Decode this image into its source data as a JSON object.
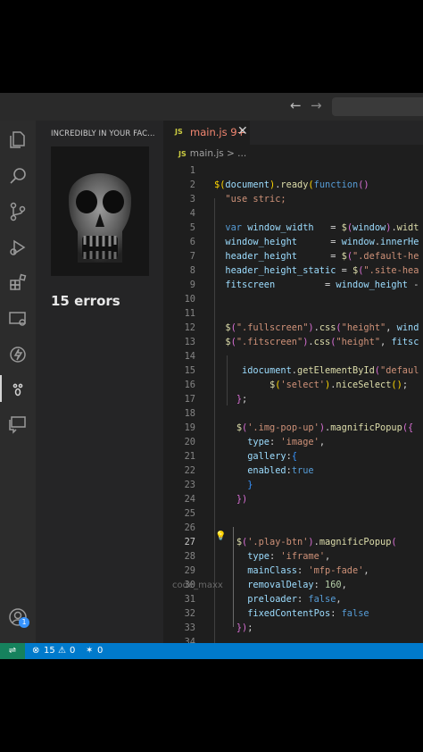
{
  "nav": {
    "back_icon": "arrow-left-icon",
    "forward_icon": "arrow-right-icon"
  },
  "sidebar": {
    "panel_title": "INCREDIBLY IN YOUR FAC...",
    "error_summary": "15 errors",
    "account_badge": "1"
  },
  "tab": {
    "lang_badge": "JS",
    "filename": "main.js 9+",
    "close_glyph": "✕"
  },
  "breadcrumb": {
    "lang_badge": "JS",
    "path": "main.js > ..."
  },
  "watermark": "code_maxx",
  "colors": {
    "status_bar": "#007acc",
    "remote": "#16825d",
    "keyword": "#569cd6",
    "string": "#ce9178",
    "function": "#dcdcaa",
    "variable": "#9cdcfe",
    "number": "#b5cea8",
    "bracket1": "#ffd700",
    "bracket2": "#da70d6"
  },
  "code_lines": [
    {
      "n": "1",
      "tokens": []
    },
    {
      "n": "2",
      "tokens": [
        [
          "#ffd700",
          "$("
        ],
        [
          "#9cdcfe",
          "document"
        ],
        [
          "#ffd700",
          ")"
        ],
        [
          "#d4d4d4",
          "."
        ],
        [
          "#dcdcaa",
          "ready"
        ],
        [
          "#ffd700",
          "("
        ],
        [
          "#569cd6",
          "function"
        ],
        [
          "#da70d6",
          "()"
        ]
      ]
    },
    {
      "n": "3",
      "tokens": [
        [
          "#ws",
          "  "
        ],
        [
          "#ce9178",
          "\"use stric;"
        ]
      ]
    },
    {
      "n": "4",
      "tokens": []
    },
    {
      "n": "5",
      "tokens": [
        [
          "#ws",
          "  "
        ],
        [
          "#569cd6",
          "var "
        ],
        [
          "#9cdcfe",
          "window_width"
        ],
        [
          "#d4d4d4",
          "   = "
        ],
        [
          "#dcdcaa",
          "$"
        ],
        [
          "#da70d6",
          "("
        ],
        [
          "#9cdcfe",
          "window"
        ],
        [
          "#da70d6",
          ")"
        ],
        [
          "#d4d4d4",
          "."
        ],
        [
          "#dcdcaa",
          "widt"
        ]
      ]
    },
    {
      "n": "6",
      "tokens": [
        [
          "#ws",
          "  "
        ],
        [
          "#9cdcfe",
          "window_height"
        ],
        [
          "#d4d4d4",
          "      = "
        ],
        [
          "#9cdcfe",
          "window"
        ],
        [
          "#d4d4d4",
          "."
        ],
        [
          "#9cdcfe",
          "innerHe"
        ]
      ]
    },
    {
      "n": "7",
      "tokens": [
        [
          "#ws",
          "  "
        ],
        [
          "#9cdcfe",
          "header_height"
        ],
        [
          "#d4d4d4",
          "      = "
        ],
        [
          "#dcdcaa",
          "$"
        ],
        [
          "#da70d6",
          "("
        ],
        [
          "#ce9178",
          "\".default-he"
        ]
      ]
    },
    {
      "n": "8",
      "tokens": [
        [
          "#ws",
          "  "
        ],
        [
          "#9cdcfe",
          "header_height_static"
        ],
        [
          "#d4d4d4",
          " = "
        ],
        [
          "#dcdcaa",
          "$"
        ],
        [
          "#da70d6",
          "("
        ],
        [
          "#ce9178",
          "\".site-hea"
        ]
      ]
    },
    {
      "n": "9",
      "tokens": [
        [
          "#ws",
          "  "
        ],
        [
          "#9cdcfe",
          "fitscreen"
        ],
        [
          "#d4d4d4",
          "         = "
        ],
        [
          "#9cdcfe",
          "window_height"
        ],
        [
          "#d4d4d4",
          " -"
        ]
      ]
    },
    {
      "n": "10",
      "tokens": []
    },
    {
      "n": "11",
      "tokens": []
    },
    {
      "n": "12",
      "tokens": [
        [
          "#ws",
          "  "
        ],
        [
          "#dcdcaa",
          "$"
        ],
        [
          "#da70d6",
          "("
        ],
        [
          "#ce9178",
          "\".fullscreen\""
        ],
        [
          "#da70d6",
          ")"
        ],
        [
          "#d4d4d4",
          "."
        ],
        [
          "#dcdcaa",
          "css"
        ],
        [
          "#da70d6",
          "("
        ],
        [
          "#ce9178",
          "\"height\""
        ],
        [
          "#d4d4d4",
          ", "
        ],
        [
          "#9cdcfe",
          "wind"
        ]
      ]
    },
    {
      "n": "13",
      "tokens": [
        [
          "#ws",
          "  "
        ],
        [
          "#dcdcaa",
          "$"
        ],
        [
          "#da70d6",
          "("
        ],
        [
          "#ce9178",
          "\".fitscreen\""
        ],
        [
          "#da70d6",
          ")"
        ],
        [
          "#d4d4d4",
          "."
        ],
        [
          "#dcdcaa",
          "css"
        ],
        [
          "#da70d6",
          "("
        ],
        [
          "#ce9178",
          "\"height\""
        ],
        [
          "#d4d4d4",
          ", "
        ],
        [
          "#9cdcfe",
          "fitsc"
        ]
      ]
    },
    {
      "n": "14",
      "tokens": []
    },
    {
      "n": "15",
      "tokens": [
        [
          "#ws",
          "     "
        ],
        [
          "#9cdcfe",
          "idocument"
        ],
        [
          "#d4d4d4",
          "."
        ],
        [
          "#dcdcaa",
          "getElementById"
        ],
        [
          "#da70d6",
          "("
        ],
        [
          "#ce9178",
          "\"defaul"
        ]
      ]
    },
    {
      "n": "16",
      "tokens": [
        [
          "#ws",
          "          "
        ],
        [
          "#dcdcaa",
          "$"
        ],
        [
          "#ffd700",
          "("
        ],
        [
          "#ce9178",
          "'select'"
        ],
        [
          "#ffd700",
          ")"
        ],
        [
          "#d4d4d4",
          "."
        ],
        [
          "#dcdcaa",
          "niceSelect"
        ],
        [
          "#ffd700",
          "()"
        ],
        [
          "#d4d4d4",
          ";"
        ]
      ]
    },
    {
      "n": "17",
      "tokens": [
        [
          "#ws",
          "    "
        ],
        [
          "#da70d6",
          "}"
        ],
        [
          "#d4d4d4",
          ";"
        ]
      ]
    },
    {
      "n": "18",
      "tokens": []
    },
    {
      "n": "19",
      "tokens": [
        [
          "#ws",
          "    "
        ],
        [
          "#dcdcaa",
          "$"
        ],
        [
          "#da70d6",
          "("
        ],
        [
          "#ce9178",
          "'.img-pop-up'"
        ],
        [
          "#da70d6",
          ")"
        ],
        [
          "#d4d4d4",
          "."
        ],
        [
          "#dcdcaa",
          "magnificPopup"
        ],
        [
          "#da70d6",
          "({"
        ]
      ]
    },
    {
      "n": "20",
      "tokens": [
        [
          "#ws",
          "      "
        ],
        [
          "#9cdcfe",
          "type"
        ],
        [
          "#d4d4d4",
          ": "
        ],
        [
          "#ce9178",
          "'image'"
        ],
        [
          "#d4d4d4",
          ","
        ]
      ]
    },
    {
      "n": "21",
      "tokens": [
        [
          "#ws",
          "      "
        ],
        [
          "#9cdcfe",
          "gallery"
        ],
        [
          "#d4d4d4",
          ":"
        ],
        [
          "#3794ff",
          "{"
        ]
      ]
    },
    {
      "n": "22",
      "tokens": [
        [
          "#ws",
          "      "
        ],
        [
          "#9cdcfe",
          "enabled"
        ],
        [
          "#d4d4d4",
          ":"
        ],
        [
          "#569cd6",
          "true"
        ]
      ]
    },
    {
      "n": "23",
      "tokens": [
        [
          "#ws",
          "      "
        ],
        [
          "#3794ff",
          "}"
        ]
      ]
    },
    {
      "n": "24",
      "tokens": [
        [
          "#ws",
          "    "
        ],
        [
          "#da70d6",
          "})"
        ]
      ]
    },
    {
      "n": "25",
      "tokens": []
    },
    {
      "n": "26",
      "tokens": []
    },
    {
      "n": "27",
      "tokens": [
        [
          "#ws",
          "    "
        ],
        [
          "#dcdcaa",
          "$"
        ],
        [
          "#da70d6",
          "("
        ],
        [
          "#ce9178",
          "'.play-btn'"
        ],
        [
          "#da70d6",
          ")"
        ],
        [
          "#d4d4d4",
          "."
        ],
        [
          "#dcdcaa",
          "magnificPopup"
        ],
        [
          "#da70d6",
          "("
        ]
      ]
    },
    {
      "n": "28",
      "tokens": [
        [
          "#ws",
          "      "
        ],
        [
          "#9cdcfe",
          "type"
        ],
        [
          "#d4d4d4",
          ": "
        ],
        [
          "#ce9178",
          "'iframe'"
        ],
        [
          "#d4d4d4",
          ","
        ]
      ]
    },
    {
      "n": "29",
      "tokens": [
        [
          "#ws",
          "      "
        ],
        [
          "#9cdcfe",
          "mainClass"
        ],
        [
          "#d4d4d4",
          ": "
        ],
        [
          "#ce9178",
          "'mfp-fade'"
        ],
        [
          "#d4d4d4",
          ","
        ]
      ]
    },
    {
      "n": "30",
      "tokens": [
        [
          "#ws",
          "      "
        ],
        [
          "#9cdcfe",
          "removalDelay"
        ],
        [
          "#d4d4d4",
          ": "
        ],
        [
          "#b5cea8",
          "160"
        ],
        [
          "#d4d4d4",
          ","
        ]
      ]
    },
    {
      "n": "31",
      "tokens": [
        [
          "#ws",
          "      "
        ],
        [
          "#9cdcfe",
          "preloader"
        ],
        [
          "#d4d4d4",
          ": "
        ],
        [
          "#569cd6",
          "false"
        ],
        [
          "#d4d4d4",
          ","
        ]
      ]
    },
    {
      "n": "32",
      "tokens": [
        [
          "#ws",
          "      "
        ],
        [
          "#9cdcfe",
          "fixedContentPos"
        ],
        [
          "#d4d4d4",
          ": "
        ],
        [
          "#569cd6",
          "false"
        ]
      ]
    },
    {
      "n": "33",
      "tokens": [
        [
          "#ws",
          "    "
        ],
        [
          "#da70d6",
          "})"
        ],
        [
          "#d4d4d4",
          ";"
        ]
      ]
    },
    {
      "n": "34",
      "tokens": []
    }
  ],
  "current_line": "27",
  "status": {
    "errors": "15",
    "warnings": "0",
    "ports": "0"
  }
}
